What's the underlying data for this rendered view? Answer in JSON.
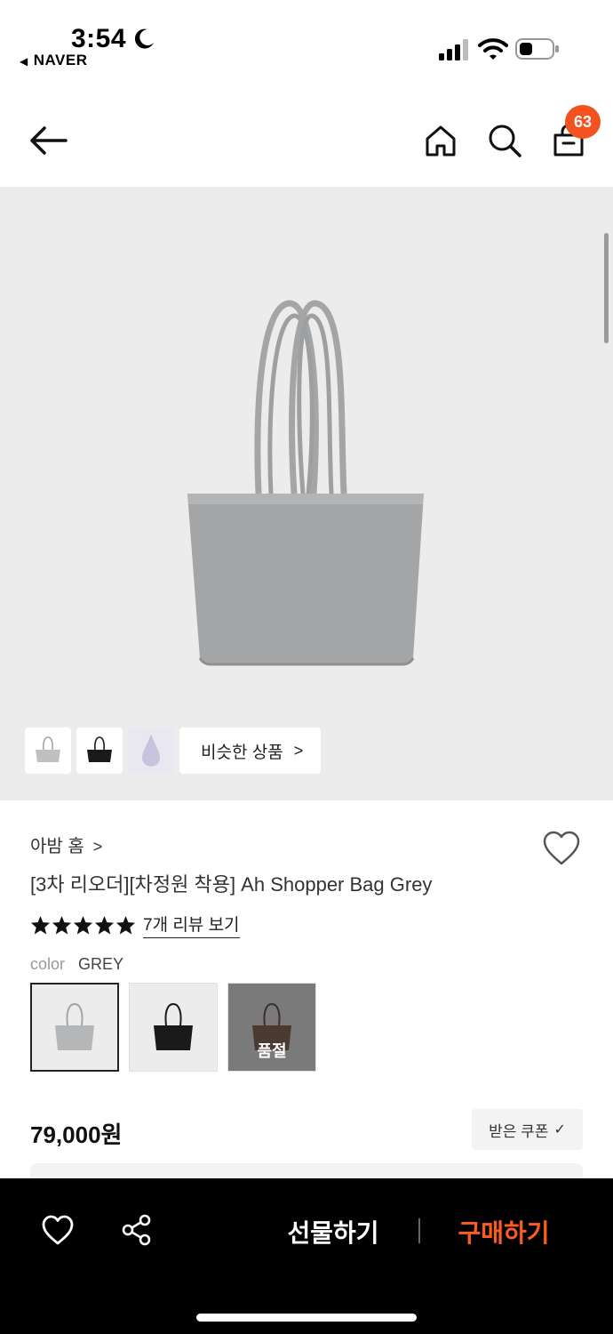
{
  "status_bar": {
    "time": "3:54",
    "back_app": "NAVER"
  },
  "header": {
    "cart_count": "63"
  },
  "gallery": {
    "similar_label": "비슷한 상품"
  },
  "product": {
    "store": "아밤 홈",
    "title": "[3차 리오더][차정원 착용] Ah Shopper Bag Grey",
    "rating_stars": 5,
    "review_link": "7개 리뷰 보기",
    "color_label": "color",
    "color_value": "GREY",
    "soldout_label": "품절",
    "price": "79,000원",
    "coupon_label": "받은 쿠폰"
  },
  "bottom_bar": {
    "gift_label": "선물하기",
    "buy_label": "구매하기"
  },
  "colors": {
    "accent": "#ff5a1f",
    "badge": "#f4511e",
    "bag_grey": "#a4a5a7",
    "bag_black": "#1a1a1a",
    "bag_brown": "#4a3a30"
  }
}
